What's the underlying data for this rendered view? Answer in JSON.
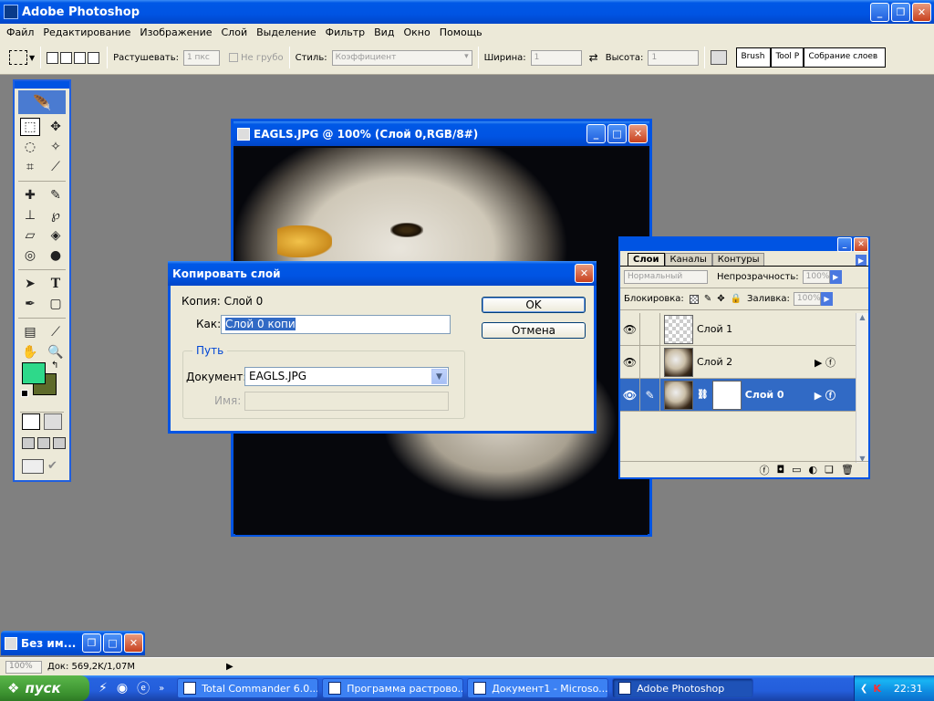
{
  "app": {
    "title": "Adobe Photoshop"
  },
  "menu": [
    "Файл",
    "Редактирование",
    "Изображение",
    "Слой",
    "Выделение",
    "Фильтр",
    "Вид",
    "Окно",
    "Помощь"
  ],
  "options": {
    "feather_label": "Растушевать:",
    "feather_value": "1 пкс",
    "antialias_label": "Не грубо",
    "style_label": "Стиль:",
    "style_value": "Коэффициент",
    "width_label": "Ширина:",
    "width_value": "1",
    "height_label": "Высота:",
    "height_value": "1",
    "well_tabs": [
      "Brush",
      "Tool P",
      "Собрание слоев"
    ]
  },
  "document": {
    "title": "EAGLS.JPG @ 100% (Слой 0,RGB/8#)"
  },
  "dialog": {
    "title": "Копировать слой",
    "copy_label": "Копия: Слой 0",
    "as_label": "Как:",
    "as_value": "Слой 0 копи",
    "ok_label": "OK",
    "cancel_label": "Отмена",
    "group_label": "Путь",
    "doc_label": "Документ:",
    "doc_value": "EAGLS.JPG",
    "name_label": "Имя:"
  },
  "layers": {
    "tabs": [
      "Слои",
      "Каналы",
      "Контуры"
    ],
    "blend_mode": "Нормальный",
    "opacity_label": "Непрозрачность:",
    "opacity_value": "100%",
    "lock_label": "Блокировка:",
    "fill_label": "Заливка:",
    "fill_value": "100%",
    "items": [
      {
        "name": "Слой 1",
        "selected": false
      },
      {
        "name": "Слой 2",
        "selected": false
      },
      {
        "name": "Слой 0",
        "selected": true
      }
    ]
  },
  "minidoc": {
    "title": "Без им..."
  },
  "status": {
    "zoom": "100%",
    "doc_info": "Док: 569,2K/1,07M"
  },
  "taskbar": {
    "start_label": "пуск",
    "tasks": [
      "Total Commander 6.0...",
      "Программа растрово...",
      "Документ1 - Microso...",
      "Adobe Photoshop"
    ],
    "clock": "22:31"
  }
}
